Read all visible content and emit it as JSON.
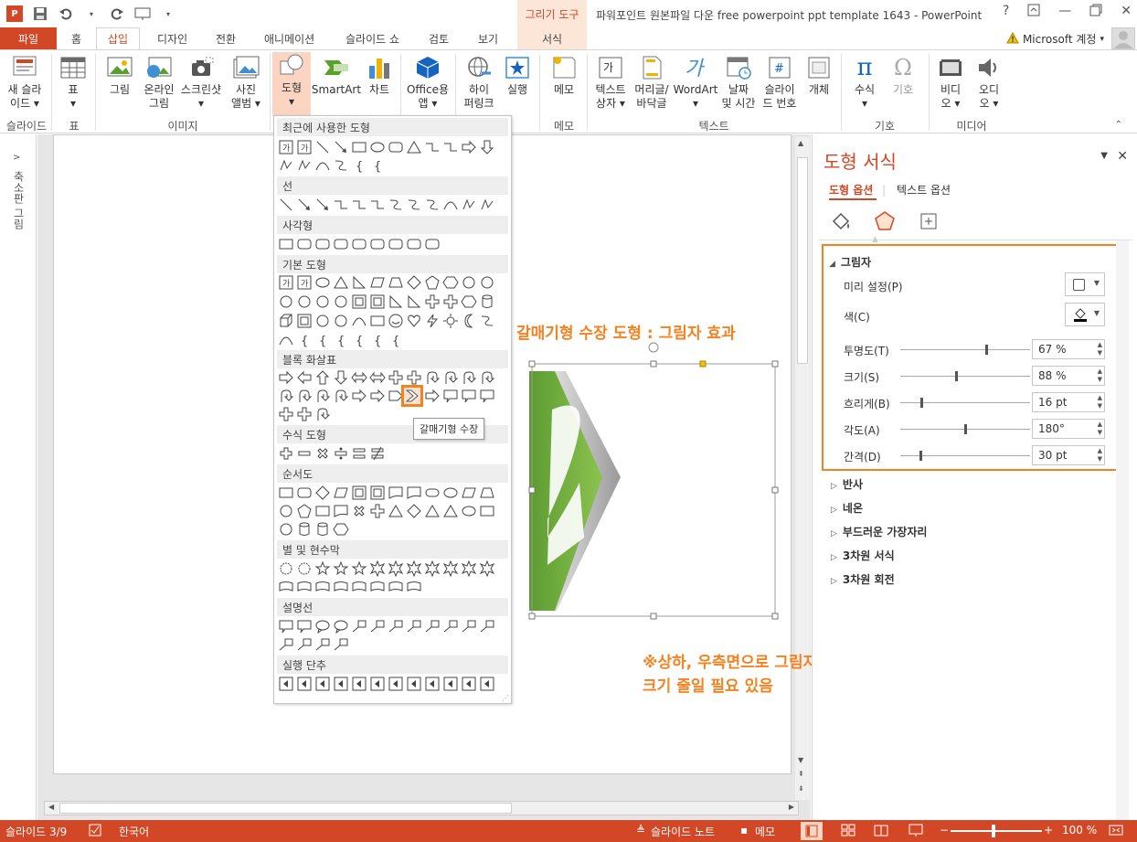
{
  "titlebar": {
    "drawing_tools": "그리기 도구",
    "title": "파워포인트 원본파일 다운 free powerpoint ppt template 1643 - PowerPoint",
    "help": "?",
    "minimize": "—",
    "close": "✕"
  },
  "tabs": {
    "file": "파일",
    "items": [
      "홈",
      "삽입",
      "디자인",
      "전환",
      "애니메이션",
      "슬라이드 쇼",
      "검토",
      "보기",
      "서식"
    ],
    "account": "Microsoft 계정"
  },
  "ribbon": {
    "buttons": [
      {
        "label": "새 슬라\n이드 ▾",
        "icon": "new-slide-icon"
      },
      {
        "label": "표\n▾",
        "icon": "table-icon"
      },
      {
        "label": "그림",
        "icon": "picture-icon"
      },
      {
        "label": "온라인\n그림",
        "icon": "online-picture-icon"
      },
      {
        "label": "스크린샷\n▾",
        "icon": "screenshot-icon"
      },
      {
        "label": "사진\n앨범 ▾",
        "icon": "photo-album-icon"
      },
      {
        "label": "도형\n▾",
        "icon": "shapes-icon"
      },
      {
        "label": "SmartArt",
        "icon": "smartart-icon"
      },
      {
        "label": "차트",
        "icon": "chart-icon"
      },
      {
        "label": "Office용\n앱 ▾",
        "icon": "office-apps-icon"
      },
      {
        "label": "하이\n퍼링크",
        "icon": "hyperlink-icon"
      },
      {
        "label": "실행",
        "icon": "action-icon"
      },
      {
        "label": "메모",
        "icon": "comment-icon"
      },
      {
        "label": "텍스트\n상자 ▾",
        "icon": "textbox-icon"
      },
      {
        "label": "머리글/\n바닥글",
        "icon": "header-footer-icon"
      },
      {
        "label": "WordArt\n▾",
        "icon": "wordart-icon"
      },
      {
        "label": "날짜\n및 시간",
        "icon": "date-time-icon"
      },
      {
        "label": "슬라이\n드 번호",
        "icon": "slide-number-icon"
      },
      {
        "label": "개체",
        "icon": "object-icon"
      },
      {
        "label": "수식\n▾",
        "icon": "equation-icon"
      },
      {
        "label": "기호",
        "icon": "symbol-icon"
      },
      {
        "label": "비디\n오 ▾",
        "icon": "video-icon"
      },
      {
        "label": "오디\n오 ▾",
        "icon": "audio-icon"
      }
    ],
    "groups": [
      "슬라이드",
      "표",
      "이미지",
      "메모",
      "텍스트",
      "기호",
      "미디어"
    ]
  },
  "left_panel": {
    "label": "축소판 그림"
  },
  "shapes_menu": {
    "categories": [
      "최근에 사용한 도형",
      "선",
      "사각형",
      "기본 도형",
      "블록 화살표",
      "수식 도형",
      "순서도",
      "별 및 현수막",
      "설명선",
      "실행 단추"
    ],
    "basic_text_glyphs": [
      "{",
      "}",
      "{",
      "}"
    ],
    "tooltip": "갈매기형 수장"
  },
  "annotations": {
    "top": "갈매기형 수장 도형 : 그림자 효과",
    "bottom_line1": "※상하, 우측면으로 그림자가 보이지 않도록 하기 위해",
    "bottom_line2": "크기 줄일 필요 있음"
  },
  "format_pane": {
    "title": "도형 서식",
    "tab_shape": "도형 옵션",
    "tab_text": "텍스트 옵션",
    "shadow_section": "그림자",
    "preset_label": "미리 설정(P)",
    "color_label": "색(C)",
    "props": [
      {
        "label": "투명도(T)",
        "value": "67 %",
        "level": 0.67
      },
      {
        "label": "크기(S)",
        "value": "88 %",
        "level": 0.43
      },
      {
        "label": "흐리게(B)",
        "value": "16 pt",
        "level": 0.16
      },
      {
        "label": "각도(A)",
        "value": "180°",
        "level": 0.5
      },
      {
        "label": "간격(D)",
        "value": "30 pt",
        "level": 0.15
      }
    ],
    "sections": [
      "반사",
      "네온",
      "부드러운 가장자리",
      "3차원 서식",
      "3차원 회전"
    ]
  },
  "status": {
    "slide": "슬라이드 3/9",
    "lang": "한국어",
    "notes": "슬라이드 노트",
    "comments": "메모",
    "zoom": "100 %"
  },
  "colors": {
    "accent": "#d24726",
    "annotation": "#f58220",
    "green": "#7ab648"
  }
}
